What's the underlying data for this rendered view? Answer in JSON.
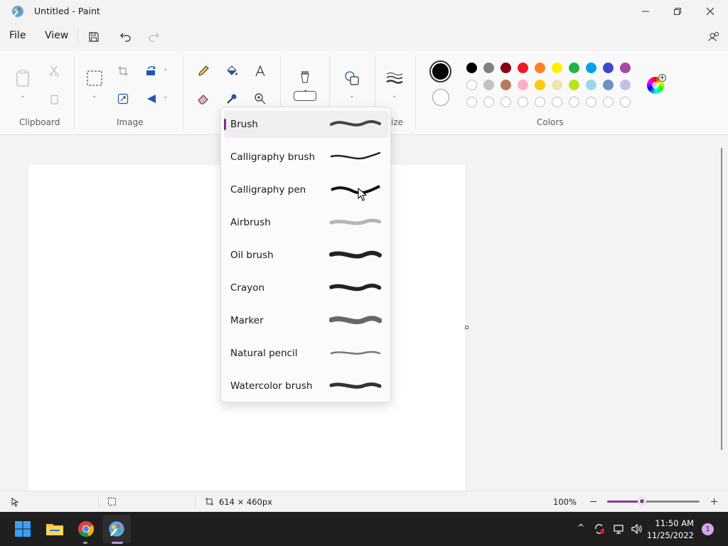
{
  "window": {
    "title": "Untitled - Paint"
  },
  "menu": {
    "file": "File",
    "view": "View"
  },
  "ribbon": {
    "groups": {
      "clipboard": "Clipboard",
      "image": "Image",
      "size_partial": "ize",
      "colors": "Colors"
    }
  },
  "colors": {
    "primary": "#000000",
    "secondary": "#ffffff",
    "row1": [
      "#000000",
      "#7f7f7f",
      "#880015",
      "#ed1c24",
      "#ff7f27",
      "#fff200",
      "#22b14c",
      "#00a2e8",
      "#3f48cc",
      "#a349a4"
    ],
    "row2": [
      "#ffffff",
      "#c3c3c3",
      "#b97a57",
      "#ffaec9",
      "#ffc90e",
      "#efe4b0",
      "#b5e61d",
      "#99d9ea",
      "#7092be",
      "#c8bfe7"
    ]
  },
  "brushes": [
    {
      "label": "Brush",
      "selected": true
    },
    {
      "label": "Calligraphy brush"
    },
    {
      "label": "Calligraphy pen"
    },
    {
      "label": "Airbrush"
    },
    {
      "label": "Oil brush"
    },
    {
      "label": "Crayon"
    },
    {
      "label": "Marker"
    },
    {
      "label": "Natural pencil"
    },
    {
      "label": "Watercolor brush"
    }
  ],
  "status": {
    "canvas_size": "614 × 460px",
    "zoom": "100%",
    "zoom_level": 0.38
  },
  "taskbar": {
    "time": "11:50 AM",
    "date": "11/25/2022",
    "notification_count": "1"
  },
  "accent_color": "#7a2d8c"
}
